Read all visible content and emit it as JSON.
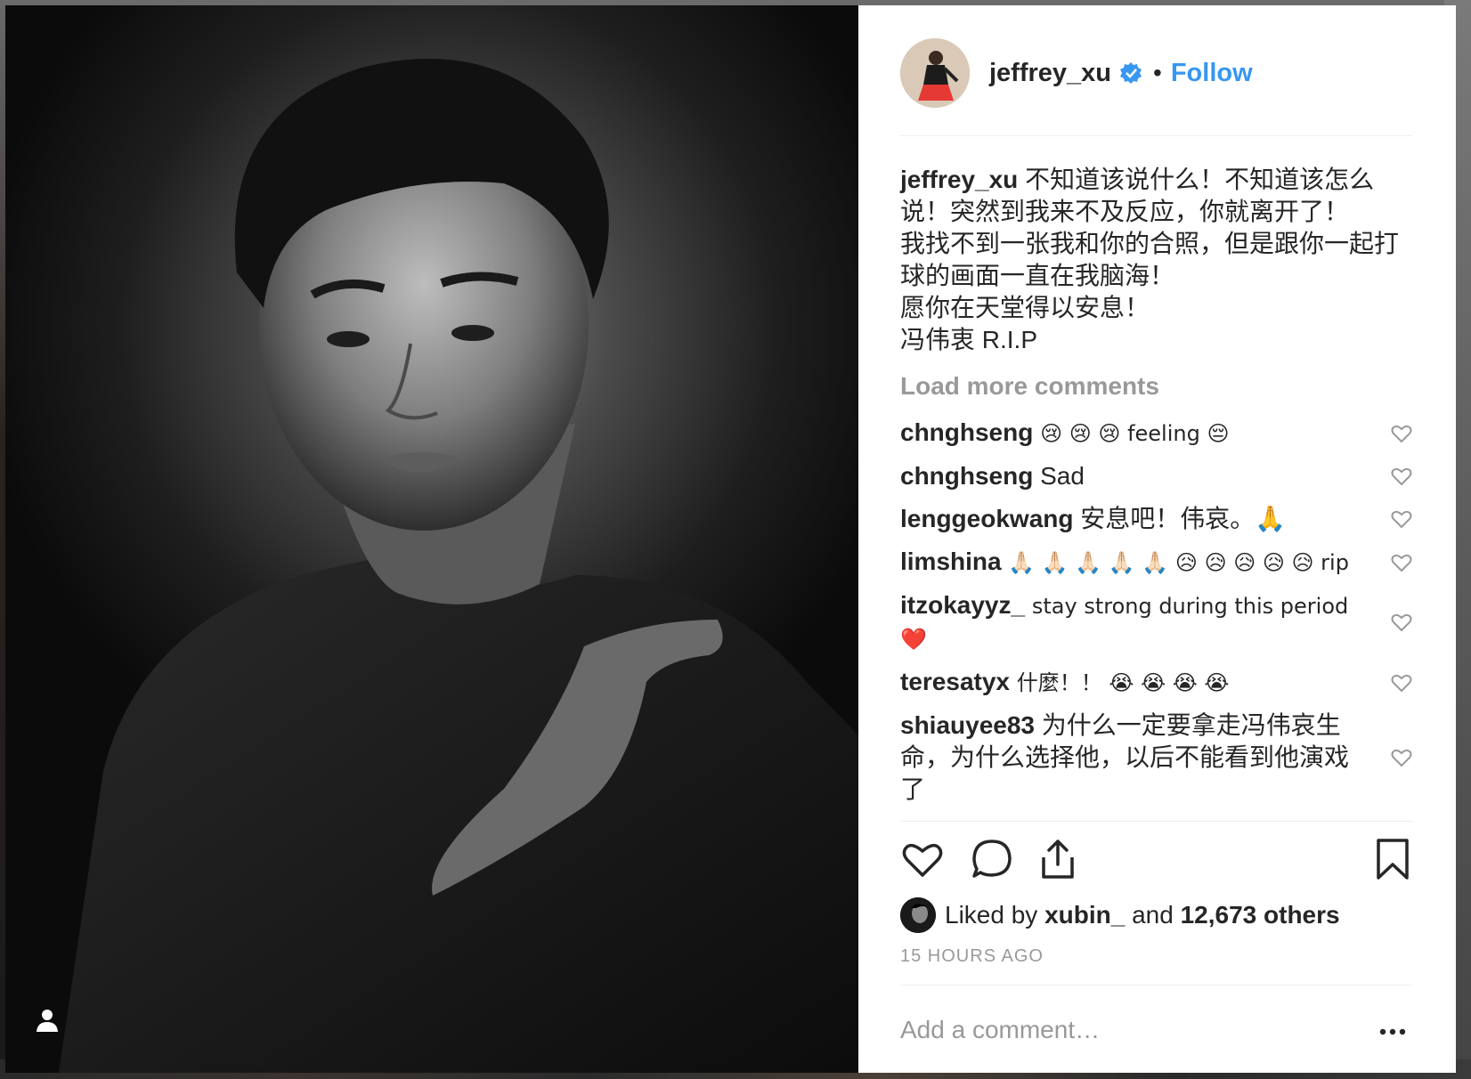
{
  "post": {
    "username": "jeffrey_xu",
    "follow_label": "Follow",
    "separator": "•",
    "caption_lines": [
      "不知道该说什么！不知道该怎么",
      "说！突然到我来不及反应，你就离开了！",
      "我找不到一张我和你的合照，但是跟你一起打",
      "球的画面一直在我脑海！",
      "愿你在天堂得以安息！",
      "冯伟衷 R.I.P"
    ],
    "load_more_label": "Load more comments",
    "comments": [
      {
        "user": "chnghseng",
        "text": "😢 😢 😢 feeling 😔"
      },
      {
        "user": "chnghseng",
        "text": "Sad"
      },
      {
        "user": "lenggeokwang",
        "text": "安息吧！伟哀。🙏"
      },
      {
        "user": "limshina",
        "text": "🙏🏻 🙏🏻 🙏🏻 🙏🏻 🙏🏻 😥 😥 😥 😥 😥 rip"
      },
      {
        "user": "itzokayyz_",
        "text": "stay strong during this period ❤️"
      },
      {
        "user": "teresatyx",
        "text": "什麼！！ 😭 😭 😭 😭"
      },
      {
        "user": "shiauyee83",
        "text": "为什么一定要拿走冯伟哀生命，为什么选择他，以后不能看到他演戏了"
      }
    ],
    "likes": {
      "prefix": "Liked by",
      "liker": "xubin_",
      "conjunction": "and",
      "others": "12,673 others"
    },
    "timestamp": "15 HOURS AGO",
    "add_comment_placeholder": "Add a comment…",
    "more_options_label": "•••"
  },
  "icons": {
    "verified": "verified-badge-icon",
    "like": "heart-icon",
    "comment": "speech-bubble-icon",
    "share": "share-upload-icon",
    "save": "bookmark-icon",
    "tag": "person-tag-icon"
  },
  "colors": {
    "link_blue": "#3897f0",
    "text": "#262626",
    "muted": "#999999"
  }
}
